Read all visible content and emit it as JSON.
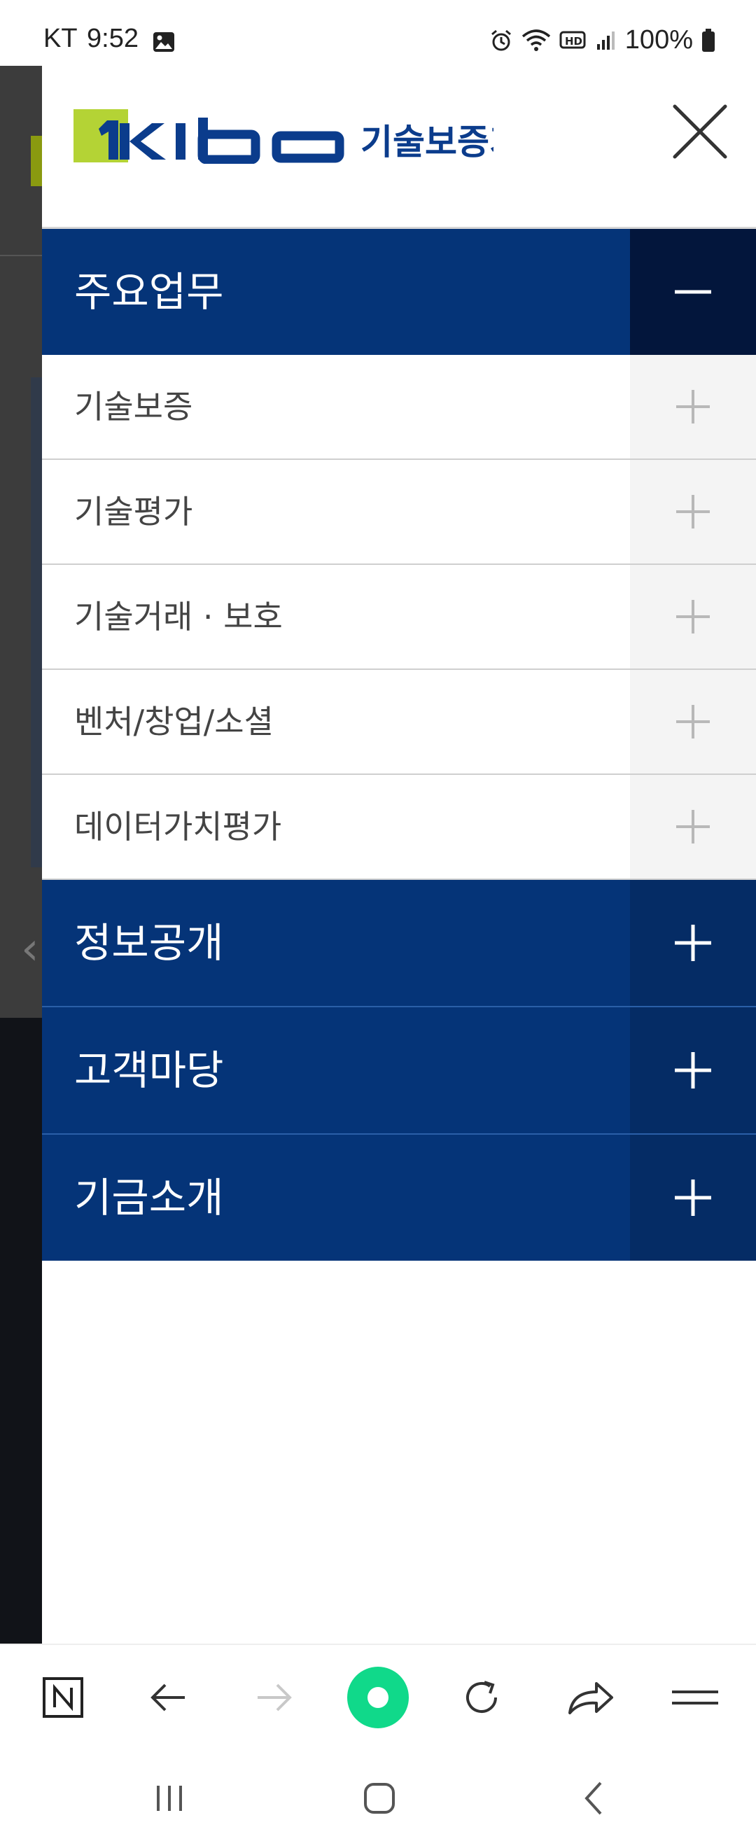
{
  "status_bar": {
    "carrier": "KT",
    "time": "9:52",
    "battery": "100%",
    "icons": [
      "gallery-icon",
      "alarm-icon",
      "wifi-icon",
      "hd-voice-icon",
      "signal-icon",
      "battery-icon"
    ]
  },
  "drawer": {
    "logo": {
      "wordmark": "KIbo",
      "name_ko": "기술보증기금",
      "colors": {
        "accent": "#b4d335",
        "navy": "#0b3c8c"
      }
    },
    "close_icon": "close-icon",
    "sections": [
      {
        "label": "주요업무",
        "expanded": true,
        "toggle_icon": "minus-icon",
        "items": [
          {
            "label": "기술보증",
            "toggle_icon": "plus-icon"
          },
          {
            "label": "기술평가",
            "toggle_icon": "plus-icon"
          },
          {
            "label": "기술거래 · 보호",
            "toggle_icon": "plus-icon"
          },
          {
            "label": "벤처/창업/소셜",
            "toggle_icon": "plus-icon"
          },
          {
            "label": "데이터가치평가",
            "toggle_icon": "plus-icon"
          }
        ]
      },
      {
        "label": "정보공개",
        "expanded": false,
        "toggle_icon": "plus-icon"
      },
      {
        "label": "고객마당",
        "expanded": false,
        "toggle_icon": "plus-icon"
      },
      {
        "label": "기금소개",
        "expanded": false,
        "toggle_icon": "plus-icon"
      }
    ],
    "colors": {
      "section_bg": "#053478",
      "section_toggle_bg": "#052c65",
      "section_open_toggle_bg": "#03163c",
      "sub_item_text": "#444444"
    }
  },
  "toolbar": {
    "buttons": [
      "naver-home-icon",
      "back-arrow-icon",
      "forward-arrow-icon",
      "green-dot-icon",
      "refresh-icon",
      "share-icon",
      "menu-icon"
    ],
    "forward_enabled": false,
    "accent": "#10d98a"
  },
  "nav_bar": {
    "buttons": [
      "recent-apps-icon",
      "home-icon",
      "back-icon"
    ]
  }
}
